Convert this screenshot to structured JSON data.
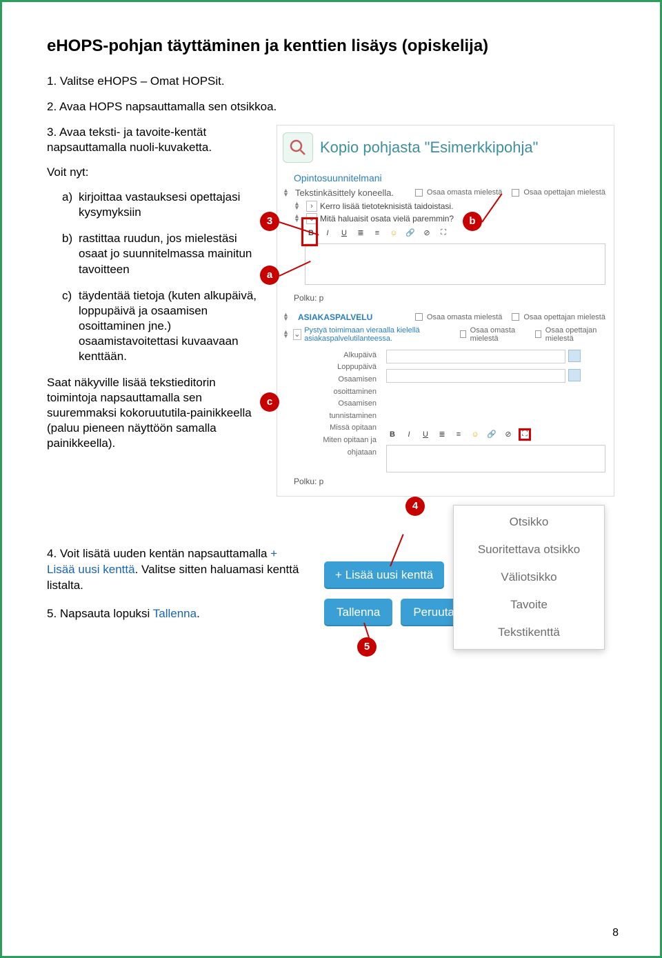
{
  "heading": "eHOPS-pohjan täyttäminen ja kenttien lisäys (opiskelija)",
  "intro": {
    "step1": "1. Valitse eHOPS – Omat HOPSit.",
    "step2": "2. Avaa HOPS napsauttamalla sen otsikkoa.",
    "step3": "3. Avaa teksti- ja tavoite-kentät napsauttamalla nuoli-kuvaketta.",
    "lead": "Voit nyt:",
    "a": "kirjoittaa vastauksesi opettajasi kysymyksiin",
    "b": "rastittaa ruudun, jos mielestäsi osaat jo suunnitelmassa mainitun tavoitteen",
    "c": "täydentää tietoja (kuten alkupäivä, loppupäivä ja osaamisen osoittaminen jne.) osaamistavoitettasi kuvaavaan kenttään.",
    "note": "Saat näkyville lisää tekstieditorin toimintoja napsauttamalla sen suuremmaksi kokoruututila-painikkeella (paluu pieneen näyttöön samalla painikkeella)."
  },
  "markers": {
    "m3": "3",
    "ma": "a",
    "mb": "b",
    "mc": "c",
    "m4": "4",
    "m5": "5"
  },
  "shot1": {
    "title": "Kopio pohjasta \"Esimerkkipohja\"",
    "sec1": "Opintosuunnitelmani",
    "field1": "Tekstinkäsittely koneella.",
    "tavoite1": "Kerro lisää tietoteknisistä taidoistasi.",
    "tavoite2": "Mitä haluaisit osata vielä paremmin?",
    "chk_own": "Osaa omasta mielestä",
    "chk_teacher": "Osaa opettajan mielestä",
    "polku": "Polku: p",
    "sec2": "ASIAKASPALVELU",
    "sec2_tavoite": "Pystyä toimimaan vieraalla kielellä asiakaspalvelutilanteessa.",
    "labels": {
      "alku": "Alkupäivä",
      "loppu": "Loppupäivä",
      "osoitt": "Osaamisen osoittaminen",
      "tunnist": "Osaamisen tunnistaminen",
      "missa": "Missä opitaan",
      "miten": "Miten opitaan ja ohjataan"
    }
  },
  "bottom": {
    "step4_a": "4. Voit lisätä uuden kentän napsauttamalla ",
    "step4_link": "+ Lisää uusi kenttä",
    "step4_b": ". Valitse sitten haluamasi kenttä listalta.",
    "step5_a": "5. Napsauta lopuksi ",
    "step5_link": "Tallenna",
    "step5_b": "."
  },
  "menu": {
    "otsikko": "Otsikko",
    "suoritettava": "Suoritettava otsikko",
    "valiotsikko": "Väliotsikko",
    "tavoite": "Tavoite",
    "tekstikentta": "Tekstikenttä"
  },
  "buttons": {
    "add": "+ Lisää uusi kenttä",
    "save": "Tallenna",
    "cancel": "Peruuta"
  },
  "pagenum": "8"
}
